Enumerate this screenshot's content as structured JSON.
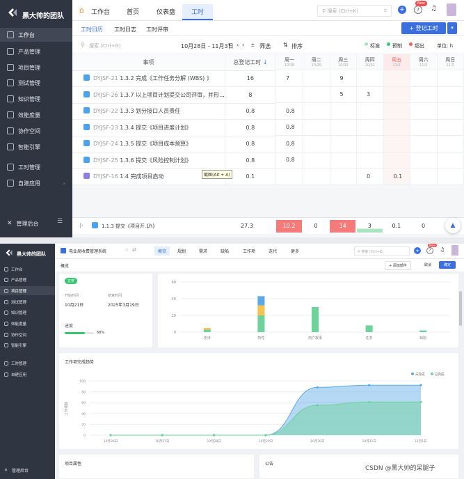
{
  "panel1": {
    "sidebar": {
      "team": "黑大帅的团队",
      "items": [
        "工作台",
        "产品管理",
        "项目管理",
        "测试管理",
        "知识管理",
        "效能度量",
        "协作空间",
        "智能引擎",
        "工时管理",
        "自建应用"
      ],
      "footer": "管理后台"
    },
    "topnav": {
      "home_tab": "工作台",
      "tabs": [
        "首页",
        "仪表盘",
        "工时"
      ],
      "search_placeholder": "搜索 (Ctrl+K)",
      "new_badge": "New"
    },
    "subtabs": [
      "工时日历",
      "工时日志",
      "工时评审"
    ],
    "register_button": "+ 登记工时",
    "toolbar": {
      "search_placeholder": "搜索 (Ctrl+G)",
      "date_range": "10月28日 - 11月3日",
      "filter": "筛选",
      "sort": "排序",
      "legend": [
        "标准",
        "预制",
        "超出"
      ],
      "unit_label": "单位: h"
    },
    "table": {
      "col_task": "事项",
      "col_total": "总登记工时",
      "days": [
        {
          "d": "周一",
          "dt": "10/28"
        },
        {
          "d": "周二",
          "dt": "10/29"
        },
        {
          "d": "周三",
          "dt": "10/30"
        },
        {
          "d": "周四",
          "dt": "10/31"
        },
        {
          "d": "周五",
          "dt": "11/1"
        },
        {
          "d": "周六",
          "dt": "11/2"
        },
        {
          "d": "周日",
          "dt": "11/3"
        }
      ],
      "rows": [
        {
          "id": "DYJSF-21",
          "name": "1.3.2 完成《工作任务分解 (WBS) 》",
          "total": "16",
          "v": [
            "7",
            "",
            "9",
            "",
            "",
            "",
            ""
          ]
        },
        {
          "id": "DYJSF-26",
          "name": "1.3.7 以上项目计划提交公司评审，并形...",
          "total": "8",
          "v": [
            "",
            "",
            "5",
            "3",
            "",
            "",
            ""
          ]
        },
        {
          "id": "DYJSF-22",
          "name": "1.3.3 划分接口人员责任",
          "total": "0.8",
          "v": [
            "0.8",
            "",
            "",
            "",
            "",
            "",
            ""
          ]
        },
        {
          "id": "DYJSF-23",
          "name": "1.3.4 提交《项目进度计划》",
          "total": "0.8",
          "v": [
            "0.8",
            "",
            "",
            "",
            "",
            "",
            ""
          ]
        },
        {
          "id": "DYJSF-24",
          "name": "1.3.5 提交《项目成本预算》",
          "total": "0.8",
          "v": [
            "0.8",
            "",
            "",
            "",
            "",
            "",
            ""
          ]
        },
        {
          "id": "DYJSF-25",
          "name": "1.3.6 提交《风险控制计划》",
          "total": "0.8",
          "v": [
            "0.8",
            "",
            "",
            "",
            "",
            "",
            ""
          ]
        },
        {
          "id": "DYJSF-16",
          "name": "1.4 完成项目启动",
          "total": "0.1",
          "v": [
            "",
            "",
            "",
            "0",
            "0.1",
            "",
            ""
          ]
        }
      ],
      "screenshot_tip": "截图(Alt + A)",
      "footer_left": "1.1.3 提交《项目开...",
      "footer_unit": "(h)",
      "footer_total": "27.3",
      "footer_vals": [
        "10.2",
        "0",
        "14",
        "3",
        "0.1",
        "0",
        ""
      ]
    }
  },
  "panel2": {
    "sidebar": {
      "team": "黑大帅的团队",
      "items": [
        "工作台",
        "产品管理",
        "项目管理",
        "测试管理",
        "知识管理",
        "效能度量",
        "协作空间",
        "智能引擎",
        "工时管理",
        "自建应用"
      ],
      "footer": "管理后台"
    },
    "topnav": {
      "project": "电业局收费管理系统",
      "tabs": [
        "概览",
        "规划",
        "需求",
        "缺陷",
        "工作项",
        "迭代",
        "更多"
      ],
      "search_placeholder": "搜索 (Ctrl+K)",
      "new_badge": "New"
    },
    "header": {
      "title": "概览",
      "add_component": "+ 添加部件",
      "cancel": "取消",
      "confirm": "确定"
    },
    "info": {
      "status": "正常",
      "start_label": "开始时间",
      "start_value": "10月21日",
      "end_label": "结束时间",
      "end_value": "2025年3月19日",
      "progress_label": "进度",
      "progress_value": "68%",
      "progress": 0.68
    },
    "chart_data": [
      {
        "type": "bar",
        "categories": [
          "史诗",
          "特性",
          "用户故事",
          "任务",
          "缺陷"
        ],
        "series": [
          {
            "name": "",
            "values": [
              3,
              20,
              30,
              8,
              2
            ],
            "color": "#6dd39a"
          },
          {
            "name": "",
            "values": [
              2,
              12,
              0,
              0,
              0
            ],
            "color": "#f7c34c"
          },
          {
            "name": "",
            "values": [
              0,
              11,
              0,
              0,
              0
            ],
            "color": "#5aa9e8"
          }
        ],
        "ylim": [
          0,
          60
        ],
        "yticks": [
          "60",
          "40",
          "20",
          "0"
        ]
      },
      {
        "type": "area",
        "title": "工作项完成趋势",
        "ylabel": "工作项数",
        "x": [
          "10月26日",
          "10月27日",
          "10月28日",
          "10月29日",
          "10月30日",
          "10月31日",
          "11月1日"
        ],
        "series": [
          {
            "name": "未完成",
            "values": [
              0,
              0,
              0,
              0,
              88,
              92,
              92
            ],
            "color": "#5aa9e8"
          },
          {
            "name": "已完成",
            "values": [
              0,
              0,
              0,
              0,
              55,
              61,
              61
            ],
            "color": "#6dd39a"
          }
        ],
        "ylim": [
          0,
          100
        ],
        "yticks": [
          "100",
          "80",
          "60",
          "40",
          "20",
          "0"
        ]
      }
    ],
    "bottom": {
      "left": "项目属性",
      "right": "公告"
    },
    "watermark": "CSDN @黑大帅的呆腿子"
  }
}
